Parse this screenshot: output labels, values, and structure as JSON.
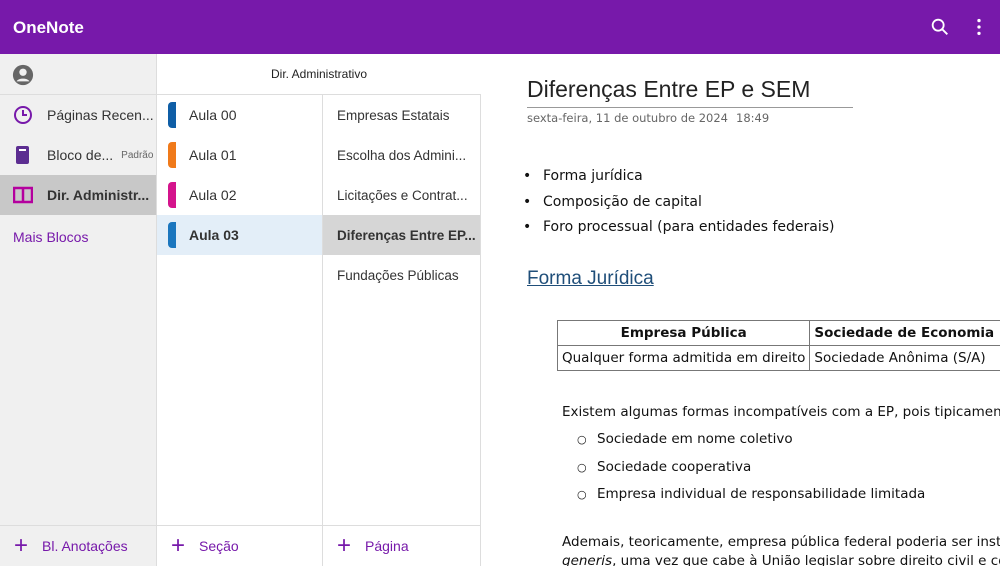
{
  "app": {
    "title": "OneNote"
  },
  "notebooks": {
    "items": [
      {
        "label": "Páginas Recen...",
        "icon": "clock-icon"
      },
      {
        "label": "Bloco de...",
        "badge": "Padrão",
        "icon": "notebook-icon"
      },
      {
        "label": "Dir. Administr...",
        "icon": "book-open-icon"
      }
    ],
    "more": "Mais Blocos",
    "add": "Bl. Anotações"
  },
  "sections": {
    "header": "Dir. Administrativo",
    "items": [
      {
        "label": "Aula 00",
        "color": "#0f5ea6"
      },
      {
        "label": "Aula 01",
        "color": "#f07a1a"
      },
      {
        "label": "Aula 02",
        "color": "#d4148c"
      },
      {
        "label": "Aula 03",
        "color": "#1b76be"
      }
    ],
    "add": "Seção"
  },
  "pages": {
    "items": [
      "Empresas Estatais",
      "Escolha dos Admini...",
      "Licitações e Contrat...",
      "Diferenças Entre EP...",
      "Fundações Públicas"
    ],
    "add": "Página"
  },
  "page": {
    "title": "Diferenças Entre EP e SEM",
    "date": "sexta-feira, 11 de outubro de 2024",
    "time": "18:49",
    "bullets": [
      "Forma jurídica",
      "Composição de capital",
      "Foro processual (para entidades federais)"
    ],
    "heading": "Forma Jurídica",
    "table": {
      "headers": [
        "Empresa Pública",
        "Sociedade de Economia Mista"
      ],
      "rows": [
        [
          "Qualquer forma admitida em direito",
          "Sociedade Anônima (S/A)"
        ]
      ]
    },
    "para1": "Existem algumas formas incompatíveis com a EP, pois tipicamente for",
    "sub": [
      "Sociedade em nome coletivo",
      "Sociedade cooperativa",
      "Empresa individual de responsabilidade limitada"
    ],
    "para2_line1": "Ademais, teoricamente, empresa pública federal poderia ser instituída",
    "para2_italic": "generis",
    "para2_line2": ", uma vez que cabe à União legislar sobre direito civil e comerc"
  }
}
